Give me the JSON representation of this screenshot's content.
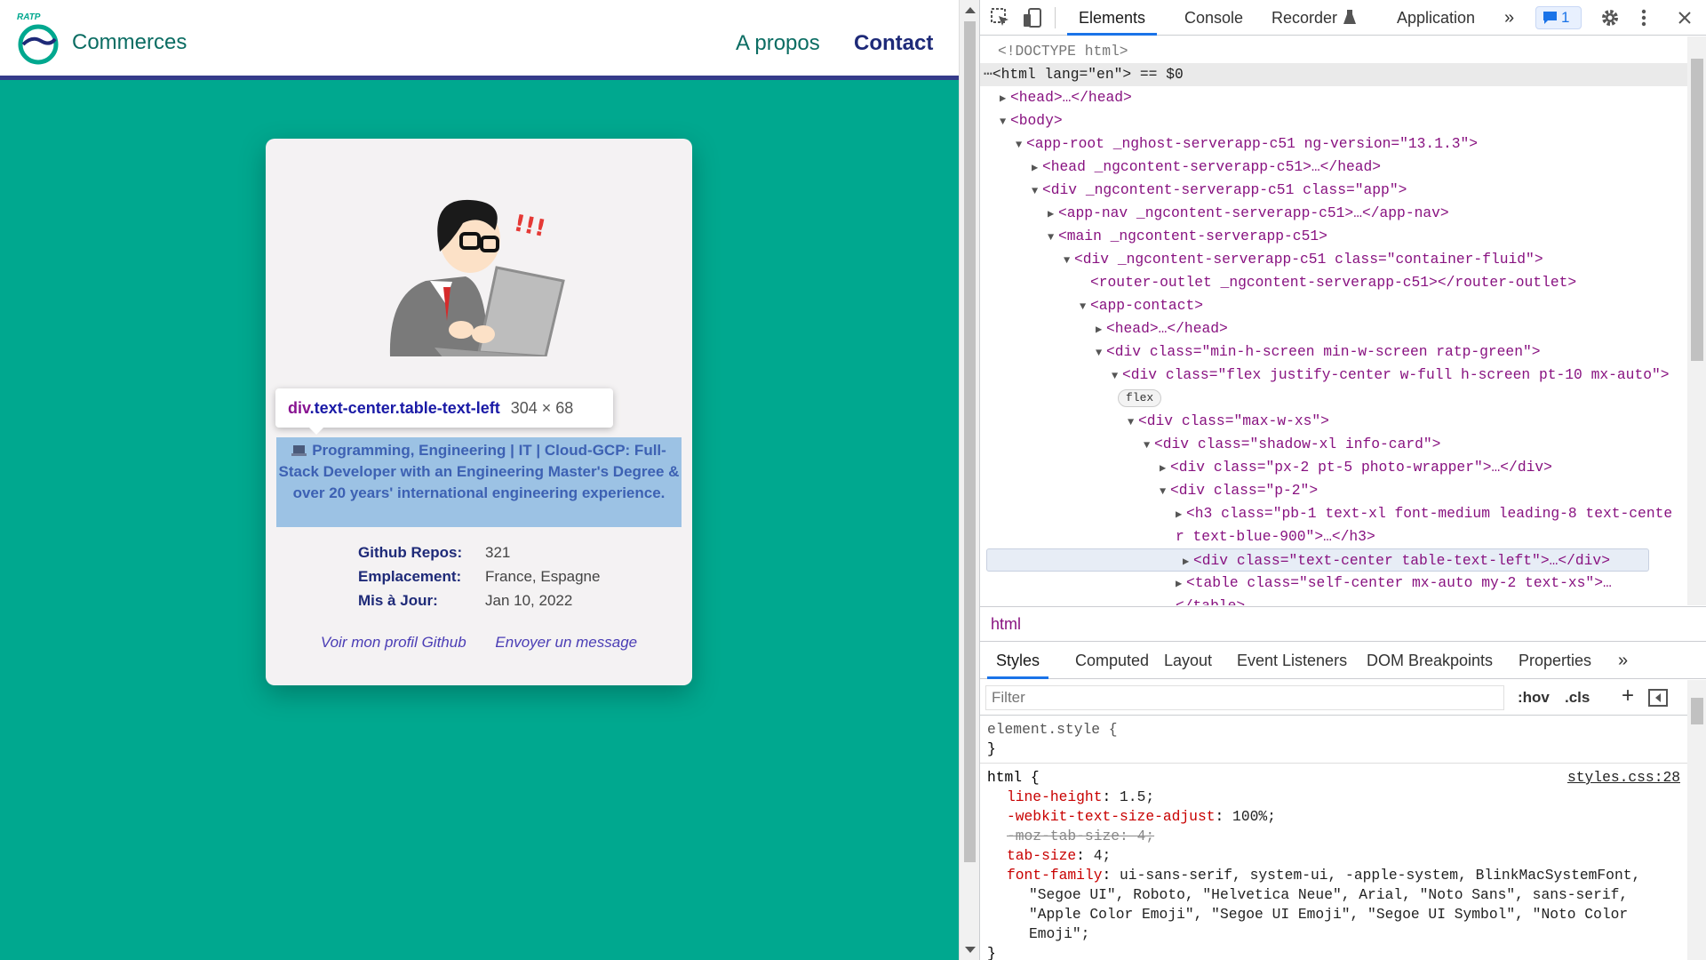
{
  "nav": {
    "brand": "Commerces",
    "logo_text": "RATP",
    "about": "A propos",
    "contact": "Contact"
  },
  "card": {
    "tooltip": {
      "tag": "div",
      "classes": ".text-center.table-text-left",
      "size": "304 × 68"
    },
    "description": "Programming, Engineering | IT | Cloud-GCP: Full-Stack Developer with an Engineering Master's Degree & over 20 years' international engineering experience.",
    "info": [
      {
        "label": "Github Repos:",
        "value": "321"
      },
      {
        "label": "Emplacement:",
        "value": "France, Espagne"
      },
      {
        "label": "Mis à Jour:",
        "value": "Jan 10, 2022"
      }
    ],
    "links": {
      "github": "Voir mon profil Github",
      "message": "Envoyer un message"
    }
  },
  "devtools": {
    "tabs": [
      "Elements",
      "Console",
      "Recorder",
      "Application"
    ],
    "issues_count": "1",
    "dom_lines": [
      {
        "text": "<!DOCTYPE html>"
      },
      {
        "text": "<html lang=\"en\"> == $0"
      },
      {
        "text": "<head>…</head>"
      },
      {
        "text": "<body>"
      },
      {
        "text": "<app-root _nghost-serverapp-c51 ng-version=\"13.1.3\">"
      },
      {
        "text": "<head _ngcontent-serverapp-c51>…</head>"
      },
      {
        "text": "<div _ngcontent-serverapp-c51 class=\"app\">"
      },
      {
        "text": "<app-nav _ngcontent-serverapp-c51>…</app-nav>"
      },
      {
        "text": "<main _ngcontent-serverapp-c51>"
      },
      {
        "text": "<div _ngcontent-serverapp-c51 class=\"container-fluid\">"
      },
      {
        "text": "<router-outlet _ngcontent-serverapp-c51></router-outlet>"
      },
      {
        "text": "<app-contact>"
      },
      {
        "text": "<head>…</head>"
      },
      {
        "text": "<div class=\"min-h-screen min-w-screen ratp-green\">"
      },
      {
        "text": "<div class=\"flex justify-center w-full h-screen pt-10 mx-auto\">"
      },
      {
        "text": "flex"
      },
      {
        "text": "<div class=\"max-w-xs\">"
      },
      {
        "text": "<div class=\"shadow-xl info-card\">"
      },
      {
        "text": "<div class=\"px-2 pt-5 photo-wrapper\">…</div>"
      },
      {
        "text": "<div class=\"p-2\">"
      },
      {
        "text": "<h3 class=\"pb-1 text-xl font-medium leading-8 text-cente"
      },
      {
        "text": "r text-blue-900\">…</h3>"
      },
      {
        "text": "<div class=\"text-center table-text-left\">…</div>"
      },
      {
        "text": "<table class=\"self-center mx-auto my-2 text-xs\">…"
      },
      {
        "text": "</table>"
      }
    ],
    "breadcrumb": "html",
    "subtabs": [
      "Styles",
      "Computed",
      "Layout",
      "Event Listeners",
      "DOM Breakpoints",
      "Properties"
    ],
    "filter_placeholder": "Filter",
    "hov": ":hov",
    "cls": ".cls",
    "styles": {
      "element_style": "element.style {",
      "close": "}",
      "html_selector": "html {",
      "source": "styles.css:28",
      "props": [
        {
          "name": "line-height",
          "value": "1.5;"
        },
        {
          "name": "-webkit-text-size-adjust",
          "value": "100%;"
        },
        {
          "name": "-moz-tab-size",
          "value": "4;"
        },
        {
          "name": "tab-size",
          "value": "4;"
        },
        {
          "name": "font-family",
          "value": "ui-sans-serif, system-ui, -apple-system, BlinkMacSystemFont,"
        }
      ],
      "font_cont": [
        "\"Segoe UI\", Roboto, \"Helvetica Neue\", Arial, \"Noto Sans\", sans-serif,",
        "\"Apple Color Emoji\", \"Segoe UI Emoji\", \"Segoe UI Symbol\", \"Noto Color",
        "Emoji\";"
      ]
    }
  }
}
